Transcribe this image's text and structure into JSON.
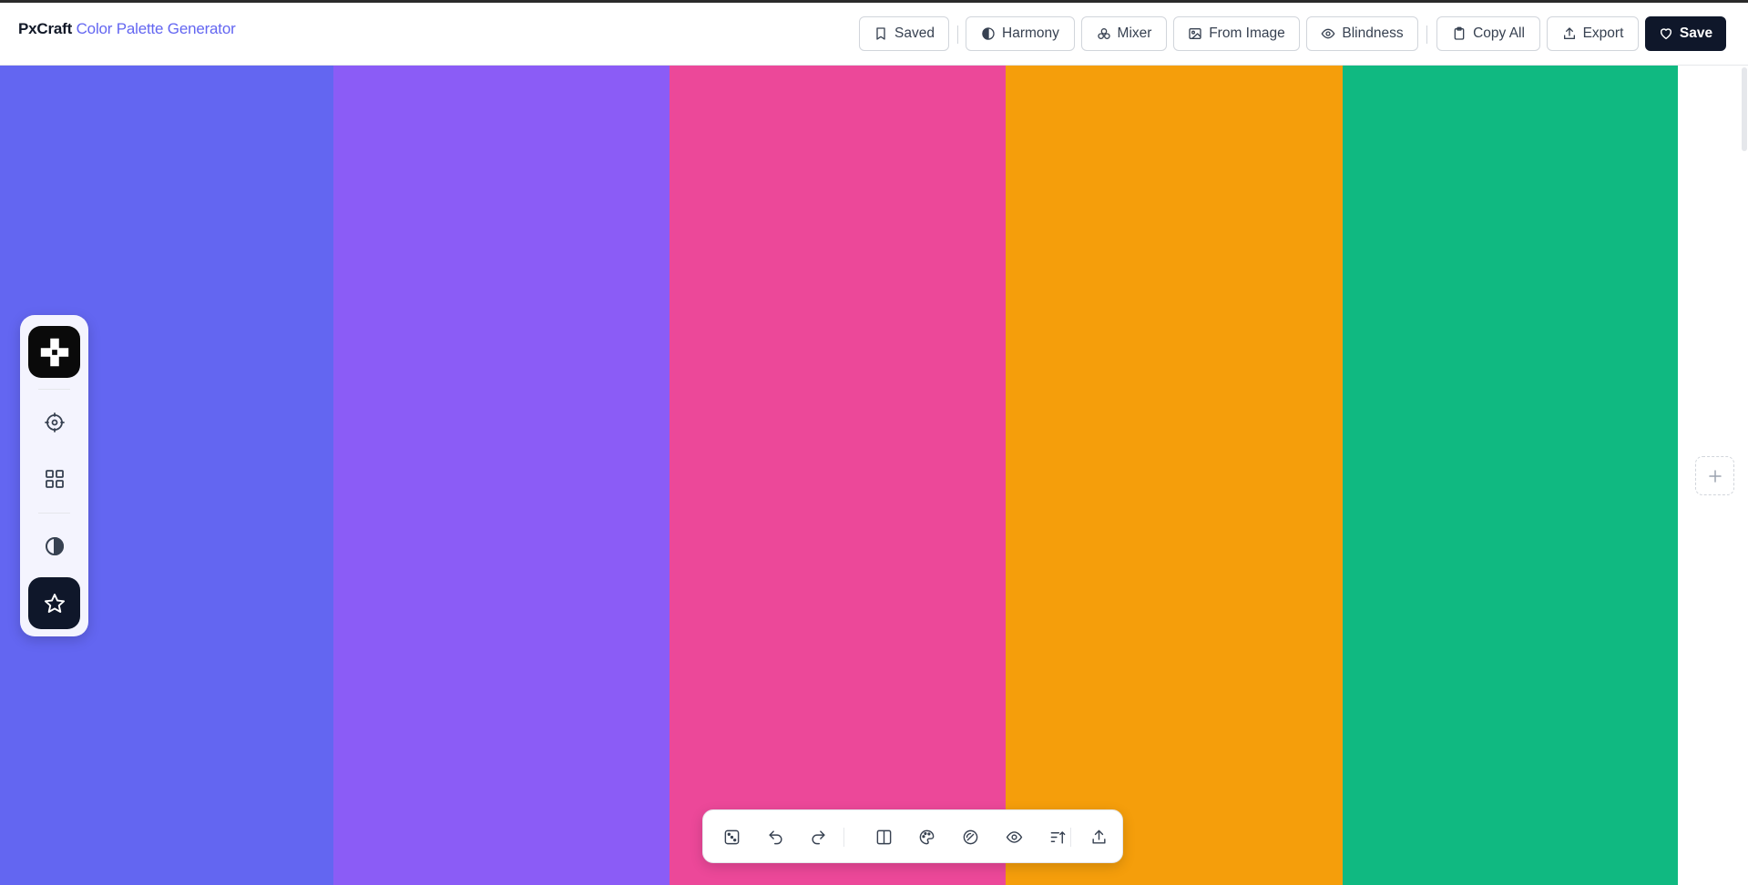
{
  "app": {
    "brand_name": "PxCraft",
    "brand_subtitle": "Color Palette Generator"
  },
  "toolbar": {
    "saved_label": "Saved",
    "harmony_label": "Harmony",
    "mixer_label": "Mixer",
    "from_image_label": "From Image",
    "blindness_label": "Blindness",
    "copy_all_label": "Copy All",
    "export_label": "Export",
    "save_label": "Save"
  },
  "palette": {
    "colors": [
      "#6366f1",
      "#8b5cf6",
      "#ec4899",
      "#f59e0b",
      "#10b981"
    ]
  },
  "side_dock": {
    "items": [
      "logo-icon",
      "target-icon",
      "grid-icon",
      "contrast-icon",
      "star-icon"
    ]
  },
  "bottom_toolbar": {
    "items": [
      "dice-icon",
      "undo-icon",
      "redo-icon",
      "columns-icon",
      "palette-icon",
      "link-icon",
      "eye-icon",
      "sort-icon",
      "upload-icon"
    ]
  },
  "add_column_icon": "plus-icon"
}
